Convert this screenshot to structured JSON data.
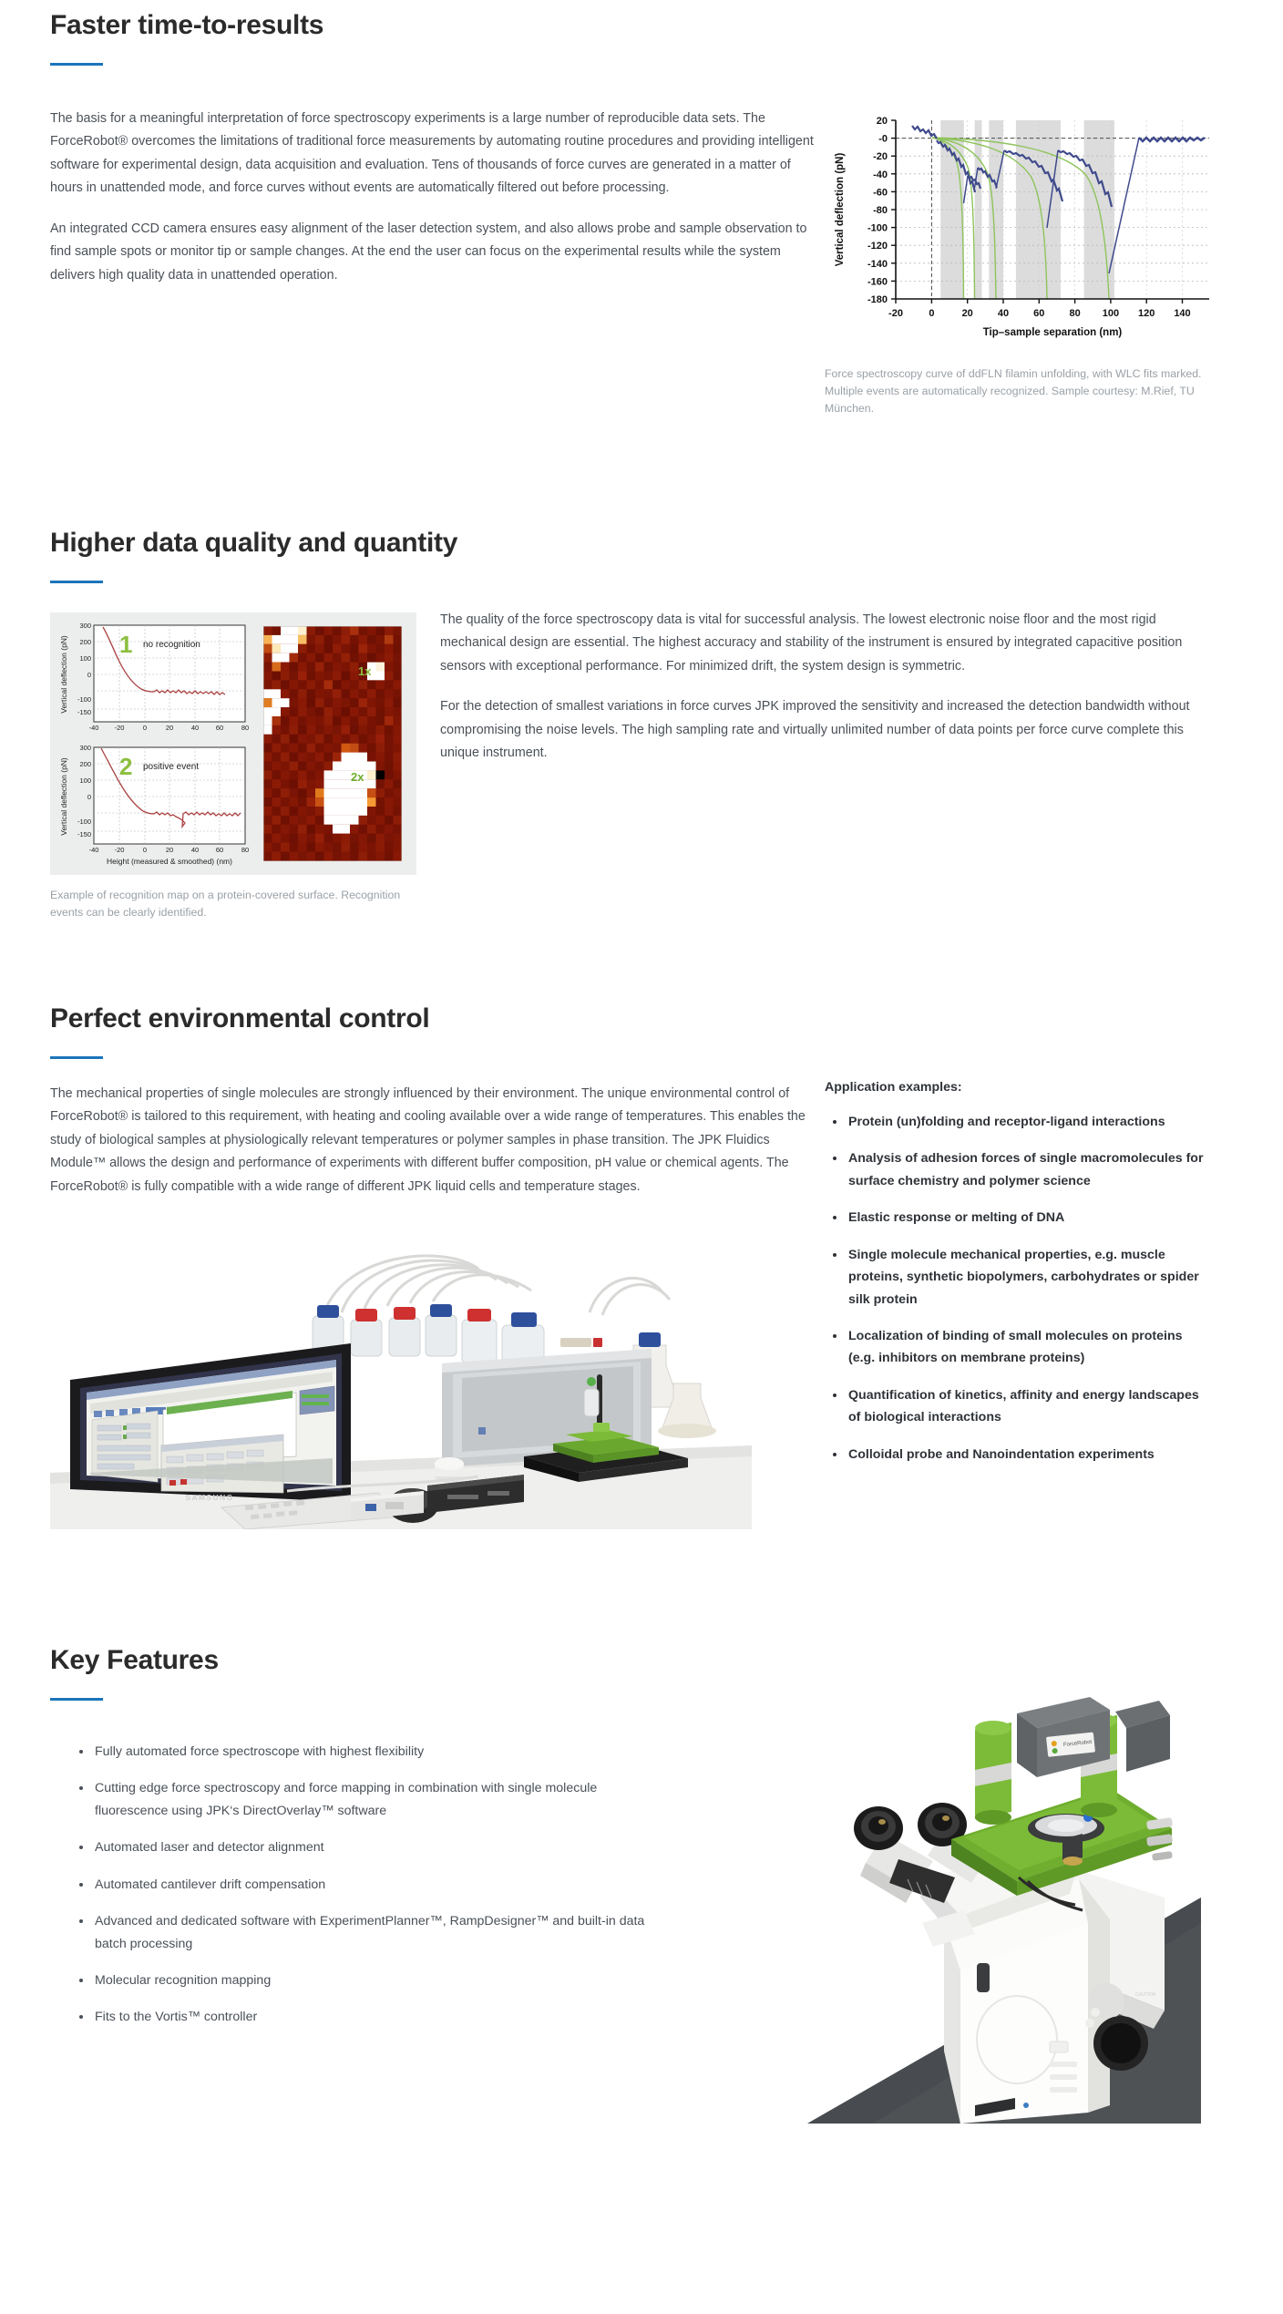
{
  "theme": {
    "accent": "#1b75bb",
    "heading": "#2b2b2b",
    "body": "#4a5057",
    "caption": "#9aa0a6"
  },
  "sections": [
    {
      "id": "faster-time-to-results",
      "title": "Faster time-to-results",
      "paragraphs": [
        "The basis for a meaningful interpretation of force spectroscopy experiments is a large number of reproducible data sets. The ForceRobot® overcomes the limitations of traditional force measurements by automating routine procedures and providing intelligent software for experimental design, data acquisition and evaluation. Tens of thousands of force curves are generated in a matter of hours in unattended mode, and force curves without events are automatically filtered out before processing.",
        "An integrated CCD camera ensures easy alignment of the laser detection system, and also allows probe and sample observation to find sample spots or monitor tip or sample changes. At the end the user can focus on the experimental results while the system delivers high quality data in unattended operation."
      ],
      "figure_caption": "Force spectroscopy curve of ddFLN filamin unfolding, with WLC fits marked. Multiple events are automatically recognized. Sample courtesy: M.Rief, TU München."
    },
    {
      "id": "higher-data-quality-and-quantity",
      "title": "Higher data quality and quantity",
      "paragraphs": [
        "The quality of the force spectroscopy data is vital for successful analysis. The lowest electronic noise floor and the most rigid mechanical design are essential. The highest accuracy and stability of the instrument is ensured by integrated capacitive position sensors with exceptional performance. For minimized drift, the system design is symmetric.",
        "For the detection of smallest variations in force curves JPK improved the sensitivity and increased the detection bandwidth without compromising the noise levels. The high sampling rate and virtually unlimited number of data points per force curve complete this unique instrument."
      ],
      "figure_caption": "Example of recognition map on a protein-covered surface. Recognition events can be clearly identified."
    },
    {
      "id": "perfect-environmental-control",
      "title": "Perfect environmental control",
      "paragraphs": [
        "The mechanical properties of single molecules are strongly influenced by their environment. The unique environmental control of ForceRobot® is tailored to this requirement, with heating and cooling available over a wide range of temperatures. This enables the study of biological samples at physiologically relevant temperatures or polymer samples in phase transition. The JPK Fluidics Module™ allows the design and performance of experiments with different buffer composition, pH value or chemical agents. The ForceRobot® is fully compatible with a wide range of different JPK liquid cells and temperature stages."
      ],
      "applications_title": "Application examples:",
      "applications": [
        "Protein (un)folding and receptor-ligand interactions",
        "Analysis of adhesion forces of single macromolecules for surface chemistry and polymer science",
        "Elastic response or melting of DNA",
        "Single molecule mechanical properties, e.g. muscle proteins, synthetic biopolymers, carbohydrates or spider silk protein",
        "Localization of binding of small molecules on proteins (e.g. inhibitors on membrane proteins)",
        "Quantification of kinetics, affinity and energy landscapes of biological interactions",
        "Colloidal probe and Nanoindentation experiments"
      ]
    },
    {
      "id": "key-features",
      "title": "Key Features",
      "features": [
        "Fully automated force spectroscope with highest flexibility",
        "Cutting edge force spectroscopy and force mapping in combination with single molecule fluorescence using JPK‘s DirectOverlay™ software",
        "Automated laser and detector alignment",
        "Automated cantilever drift compensation",
        "Advanced and dedicated software with ExperimentPlanner™, RampDesigner™ and built-in data batch processing",
        "Molecular recognition mapping",
        "Fits to the Vortis™ controller"
      ]
    }
  ],
  "chart_data": [
    {
      "type": "line",
      "title": "",
      "xlabel": "Tip–sample separation (nm)",
      "ylabel": "Vertical deflection (pN)",
      "xlim": [
        -20,
        155
      ],
      "ylim": [
        -180,
        20
      ],
      "xticks": [
        -20,
        0,
        20,
        40,
        60,
        80,
        100,
        120,
        140
      ],
      "yticks": [
        20,
        0,
        -20,
        -40,
        -60,
        -80,
        -100,
        -120,
        -140,
        -160,
        -180
      ],
      "ytick_labels": [
        "20",
        "-0",
        "-20",
        "-40",
        "-60",
        "-80",
        "-100",
        "-120",
        "-140",
        "-160",
        "-180"
      ],
      "grid": true,
      "legend": "none",
      "series": [
        {
          "name": "force curve",
          "color": "#3f4a8c"
        },
        {
          "name": "WLC fits",
          "color": "#86c45a"
        }
      ],
      "event_bands_nm": [
        [
          5,
          18
        ],
        [
          24,
          28
        ],
        [
          32,
          40
        ],
        [
          47,
          72
        ],
        [
          85,
          102
        ]
      ],
      "rupture_events_nm_pN": [
        [
          18,
          -72
        ],
        [
          27,
          -48
        ],
        [
          40,
          -47
        ],
        [
          72,
          -99
        ],
        [
          103,
          -152
        ]
      ],
      "annotation": "Force spectroscopy curve of ddFLN filamin unfolding, with WLC fits marked."
    },
    {
      "type": "line",
      "title": "no recognition",
      "panel_label": "1",
      "xlabel": "Height (measured & smoothed) (nm)",
      "ylabel": "Vertical deflection (pN)",
      "xlim": [
        -40,
        80
      ],
      "ylim": [
        -150,
        300
      ],
      "xticks": [
        -40,
        -20,
        0,
        20,
        40,
        60,
        80
      ],
      "yticks": [
        -150,
        -100,
        0,
        100,
        200,
        300
      ],
      "grid": true,
      "series": [
        {
          "name": "force curve",
          "color": "#a83f3f"
        }
      ]
    },
    {
      "type": "line",
      "title": "positive event",
      "panel_label": "2",
      "xlabel": "Height (measured & smoothed) (nm)",
      "ylabel": "Vertical deflection (pN)",
      "xlim": [
        -40,
        80
      ],
      "ylim": [
        -150,
        300
      ],
      "xticks": [
        -40,
        -20,
        0,
        20,
        40,
        60,
        80
      ],
      "yticks": [
        -150,
        -100,
        0,
        100,
        200,
        300
      ],
      "grid": true,
      "series": [
        {
          "name": "force curve",
          "color": "#a83f3f"
        }
      ],
      "event_at_nm_pN": [
        27,
        -62
      ]
    },
    {
      "type": "heatmap",
      "title": "recognition map",
      "colormap": "afmhot (dark red to white)",
      "markers": [
        {
          "label": "1x",
          "note": "no recognition location"
        },
        {
          "label": "2x",
          "note": "positive event location"
        }
      ]
    }
  ]
}
